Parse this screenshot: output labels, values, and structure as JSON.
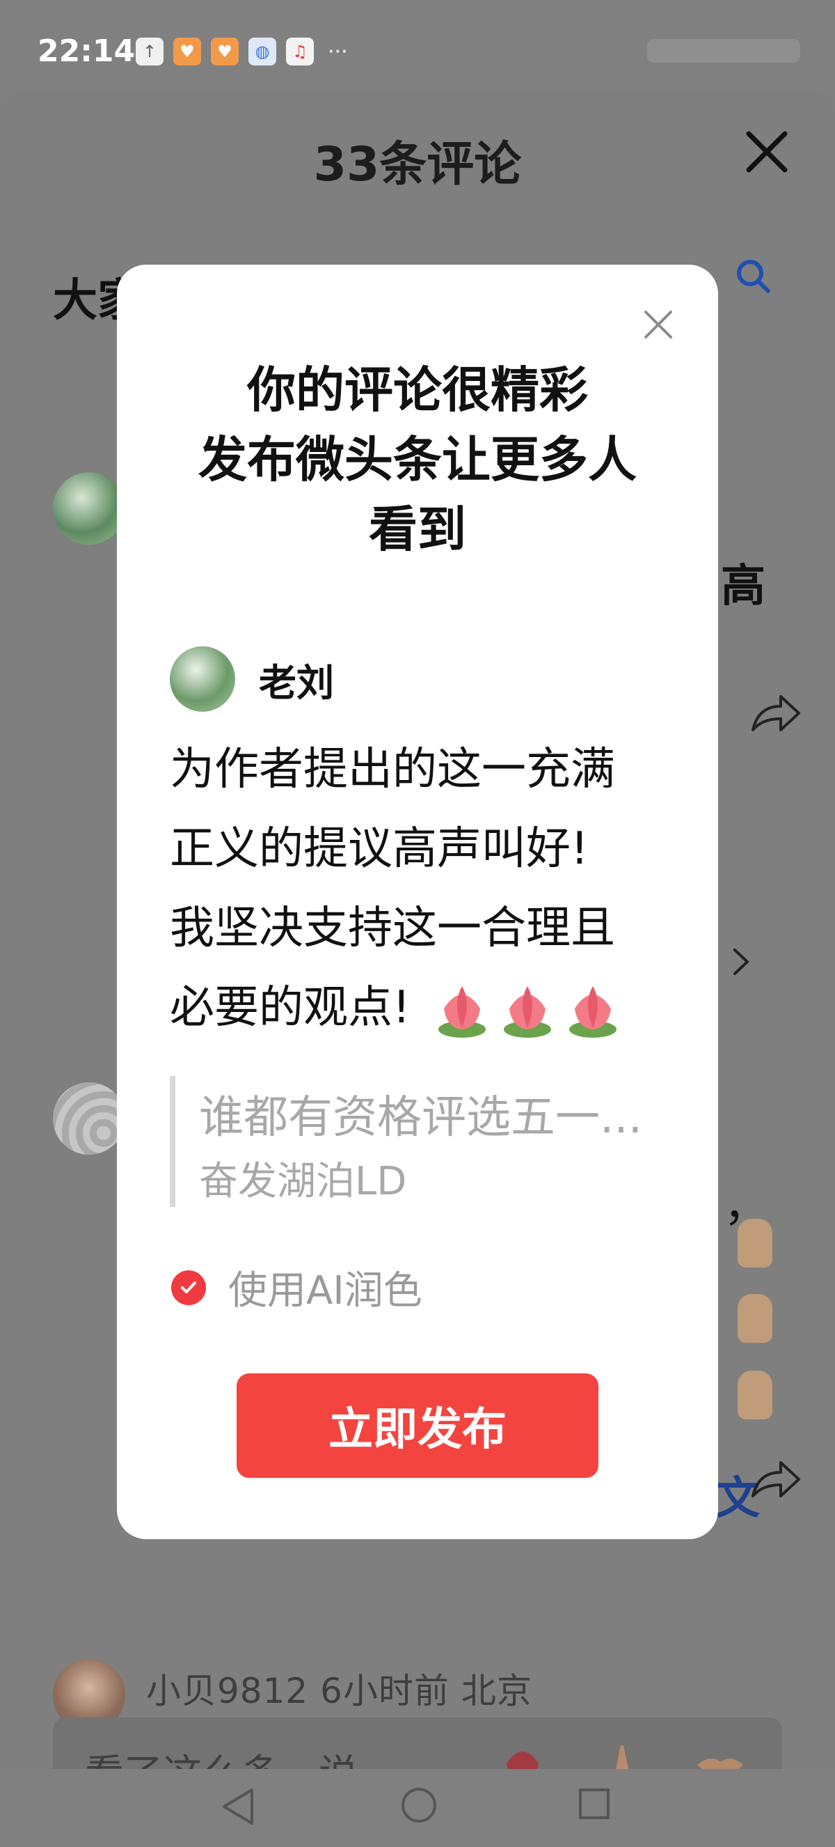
{
  "status_bar": {
    "time": "22:14",
    "more": "···"
  },
  "sheet": {
    "title": "33条评论",
    "heading_partial": "大家",
    "side_text_1": "高",
    "side_text_2": "文",
    "side_text_3": "，"
  },
  "background_user_line": "小贝9812 6小时前 北京",
  "input_bar": {
    "placeholder": "看了这么多，说..."
  },
  "modal": {
    "title_lines": [
      "你的评论很精彩",
      "发布微头条让更多人",
      "看到"
    ],
    "user_name": "老刘",
    "comment_lines": [
      "为作者提出的这一充满",
      "正义的提议高声叫好!",
      "我坚决支持这一合理且",
      "必要的观点!"
    ],
    "quote_title": "谁都有资格评选五一...",
    "quote_author": "奋发湖泊LD",
    "ai_polish_label": "使用AI润色",
    "ai_polish_checked": true,
    "publish_button": "立即发布"
  },
  "colors": {
    "accent": "#f34440",
    "overlay": "#808080"
  }
}
